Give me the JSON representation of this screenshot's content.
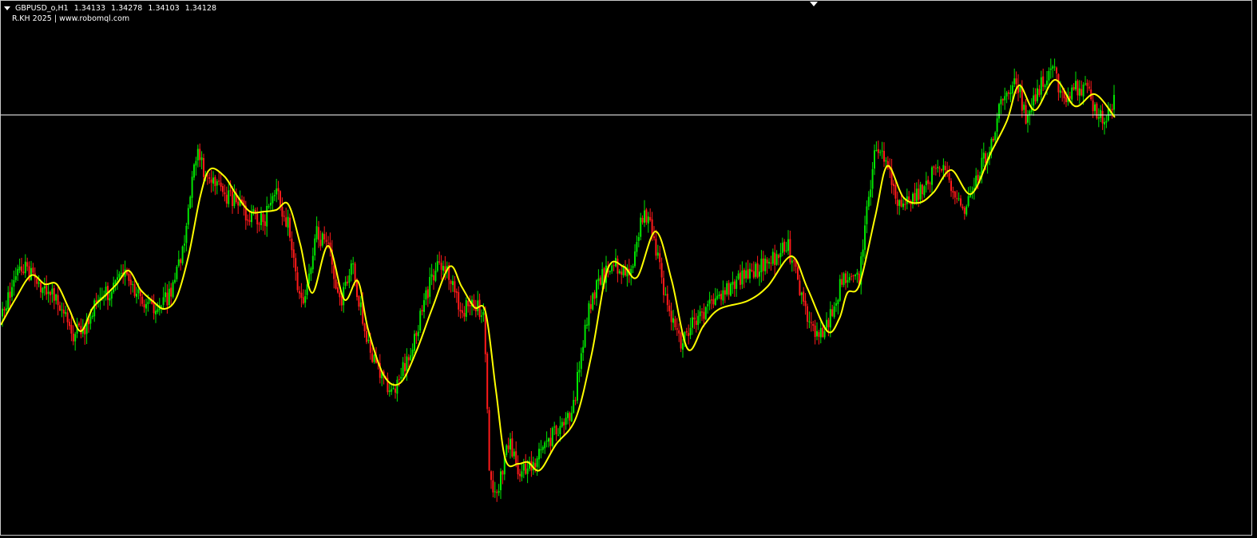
{
  "symbol_bar": {
    "symbol": "GBPUSD_o,H1",
    "open": "1.34133",
    "high": "1.34278",
    "low": "1.34103",
    "close": "1.34128"
  },
  "indicator_label": "R.KH 2025 | www.robomql.com",
  "colors": {
    "background": "#000000",
    "bull": "#00e600",
    "bear": "#ff1a1a",
    "ma_line": "#ffff00",
    "hline": "#ffffff"
  },
  "chart_data": {
    "type": "candlestick",
    "y_scale_note": "price axis not shown",
    "ylim": [
      0,
      674
    ],
    "ma_line": [
      [
        0,
        406
      ],
      [
        18,
        374
      ],
      [
        38,
        344
      ],
      [
        55,
        355
      ],
      [
        70,
        355
      ],
      [
        85,
        385
      ],
      [
        100,
        414
      ],
      [
        115,
        385
      ],
      [
        130,
        370
      ],
      [
        145,
        355
      ],
      [
        160,
        338
      ],
      [
        175,
        362
      ],
      [
        190,
        376
      ],
      [
        205,
        386
      ],
      [
        220,
        372
      ],
      [
        235,
        320
      ],
      [
        250,
        244
      ],
      [
        262,
        211
      ],
      [
        280,
        220
      ],
      [
        295,
        243
      ],
      [
        312,
        264
      ],
      [
        330,
        264
      ],
      [
        345,
        262
      ],
      [
        360,
        255
      ],
      [
        375,
        305
      ],
      [
        390,
        366
      ],
      [
        410,
        307
      ],
      [
        430,
        374
      ],
      [
        447,
        351
      ],
      [
        460,
        412
      ],
      [
        480,
        470
      ],
      [
        500,
        479
      ],
      [
        520,
        440
      ],
      [
        540,
        386
      ],
      [
        562,
        333
      ],
      [
        577,
        358
      ],
      [
        593,
        384
      ],
      [
        607,
        390
      ],
      [
        620,
        488
      ],
      [
        632,
        575
      ],
      [
        648,
        580
      ],
      [
        660,
        578
      ],
      [
        675,
        588
      ],
      [
        695,
        556
      ],
      [
        720,
        523
      ],
      [
        740,
        442
      ],
      [
        760,
        336
      ],
      [
        780,
        333
      ],
      [
        797,
        346
      ],
      [
        820,
        289
      ],
      [
        840,
        350
      ],
      [
        860,
        436
      ],
      [
        880,
        407
      ],
      [
        900,
        386
      ],
      [
        935,
        376
      ],
      [
        960,
        358
      ],
      [
        990,
        320
      ],
      [
        1010,
        360
      ],
      [
        1035,
        414
      ],
      [
        1050,
        398
      ],
      [
        1060,
        366
      ],
      [
        1075,
        356
      ],
      [
        1095,
        270
      ],
      [
        1110,
        207
      ],
      [
        1130,
        246
      ],
      [
        1150,
        253
      ],
      [
        1168,
        240
      ],
      [
        1190,
        212
      ],
      [
        1215,
        242
      ],
      [
        1240,
        190
      ],
      [
        1260,
        150
      ],
      [
        1275,
        106
      ],
      [
        1295,
        137
      ],
      [
        1320,
        99
      ],
      [
        1345,
        132
      ],
      [
        1370,
        117
      ],
      [
        1395,
        146
      ]
    ],
    "hline_y": 143,
    "trend_anchors": [
      [
        0,
        395
      ],
      [
        10,
        370
      ],
      [
        25,
        330
      ],
      [
        40,
        345
      ],
      [
        55,
        360
      ],
      [
        70,
        370
      ],
      [
        90,
        420
      ],
      [
        105,
        410
      ],
      [
        120,
        380
      ],
      [
        135,
        365
      ],
      [
        150,
        330
      ],
      [
        165,
        365
      ],
      [
        180,
        375
      ],
      [
        200,
        385
      ],
      [
        215,
        360
      ],
      [
        230,
        300
      ],
      [
        245,
        190
      ],
      [
        255,
        215
      ],
      [
        270,
        235
      ],
      [
        290,
        250
      ],
      [
        310,
        270
      ],
      [
        330,
        275
      ],
      [
        345,
        240
      ],
      [
        360,
        280
      ],
      [
        372,
        360
      ],
      [
        380,
        375
      ],
      [
        395,
        290
      ],
      [
        410,
        310
      ],
      [
        425,
        380
      ],
      [
        440,
        330
      ],
      [
        455,
        410
      ],
      [
        470,
        460
      ],
      [
        490,
        490
      ],
      [
        510,
        450
      ],
      [
        530,
        380
      ],
      [
        545,
        330
      ],
      [
        560,
        340
      ],
      [
        575,
        390
      ],
      [
        590,
        380
      ],
      [
        605,
        390
      ],
      [
        612,
        600
      ],
      [
        622,
        620
      ],
      [
        635,
        550
      ],
      [
        650,
        590
      ],
      [
        665,
        585
      ],
      [
        690,
        545
      ],
      [
        715,
        520
      ],
      [
        735,
        390
      ],
      [
        750,
        350
      ],
      [
        770,
        330
      ],
      [
        790,
        340
      ],
      [
        805,
        260
      ],
      [
        815,
        290
      ],
      [
        830,
        360
      ],
      [
        850,
        430
      ],
      [
        870,
        400
      ],
      [
        900,
        370
      ],
      [
        930,
        345
      ],
      [
        960,
        330
      ],
      [
        985,
        305
      ],
      [
        1000,
        360
      ],
      [
        1020,
        425
      ],
      [
        1040,
        395
      ],
      [
        1055,
        345
      ],
      [
        1075,
        345
      ],
      [
        1090,
        220
      ],
      [
        1095,
        180
      ],
      [
        1110,
        200
      ],
      [
        1125,
        260
      ],
      [
        1140,
        250
      ],
      [
        1160,
        225
      ],
      [
        1180,
        200
      ],
      [
        1195,
        245
      ],
      [
        1205,
        270
      ],
      [
        1220,
        225
      ],
      [
        1240,
        180
      ],
      [
        1255,
        120
      ],
      [
        1270,
        95
      ],
      [
        1285,
        150
      ],
      [
        1300,
        110
      ],
      [
        1315,
        80
      ],
      [
        1330,
        120
      ],
      [
        1345,
        110
      ],
      [
        1360,
        115
      ],
      [
        1380,
        150
      ],
      [
        1395,
        125
      ]
    ]
  }
}
